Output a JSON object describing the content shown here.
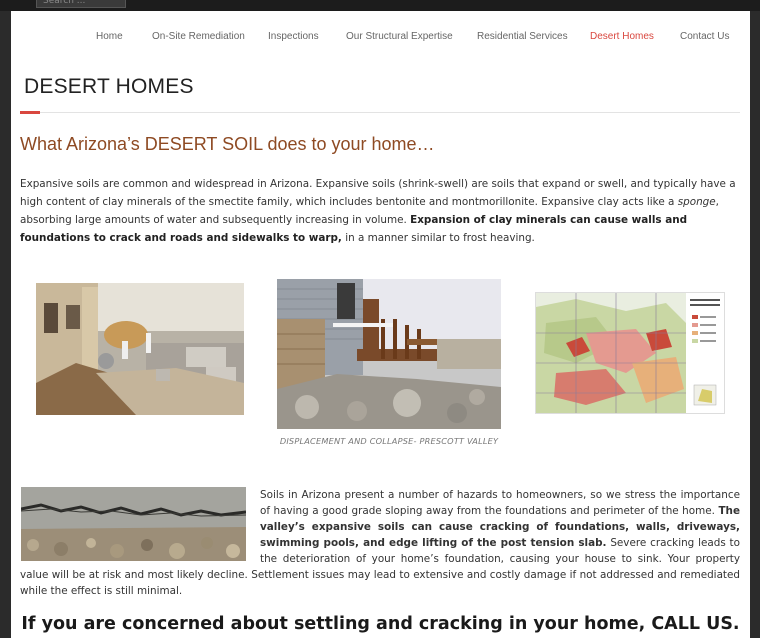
{
  "search": {
    "placeholder": "Search ..."
  },
  "nav": {
    "items": [
      {
        "label": "Home"
      },
      {
        "label": "On-Site Remediation"
      },
      {
        "label": "Inspections"
      },
      {
        "label": "Our Structural Expertise"
      },
      {
        "label": "Residential Services"
      },
      {
        "label": "Desert Homes"
      },
      {
        "label": "Contact Us"
      }
    ],
    "active_index": 5
  },
  "page": {
    "title": "DESERT HOMES",
    "headline": "What Arizona’s DESERT SOIL does to your home…",
    "intro": {
      "p1": "Expansive soils are common and widespread in Arizona.  Expansive soils (shrink-swell) are soils that expand or swell, and typically have a high content of clay minerals of the smectite family, which includes bentonite and montmorillonite.  Expansive clay acts like a ",
      "p1_em": "sponge",
      "p1_cont": ", absorbing large amounts of water and subsequently increasing in volume.  ",
      "p1_bold": "Expansion of clay minerals can cause walls and foundations to crack and roads and sidewalks to warp,",
      "p1_end": " in a manner similar to frost heaving."
    },
    "caption": "DISPLACEMENT AND COLLAPSE- PRESCOTT VALLEY",
    "body2": {
      "p_start": "Soils in Arizona present a number of hazards to homeowners, so we stress the importance of having a good grade sloping away from the foundations and perimeter of the home. ",
      "p_bold": "The valley’s expansive soils can cause cracking of foundations, walls, driveways, swimming pools, and edge lifting of the post tension slab.",
      "p_end": "  Severe cracking leads to the deterioration of your home’s foundation, causing your house to sink.  Your property value will be at risk and most likely decline.  Settlement issues may lead to extensive and costly damage if not addressed and remediated while the effect is still minimal."
    },
    "cta": "If you are concerned about settling and cracking in your home, CALL US."
  },
  "colors": {
    "accent": "#d9473f",
    "headline": "#8e4a23",
    "nav_text": "#666666"
  }
}
